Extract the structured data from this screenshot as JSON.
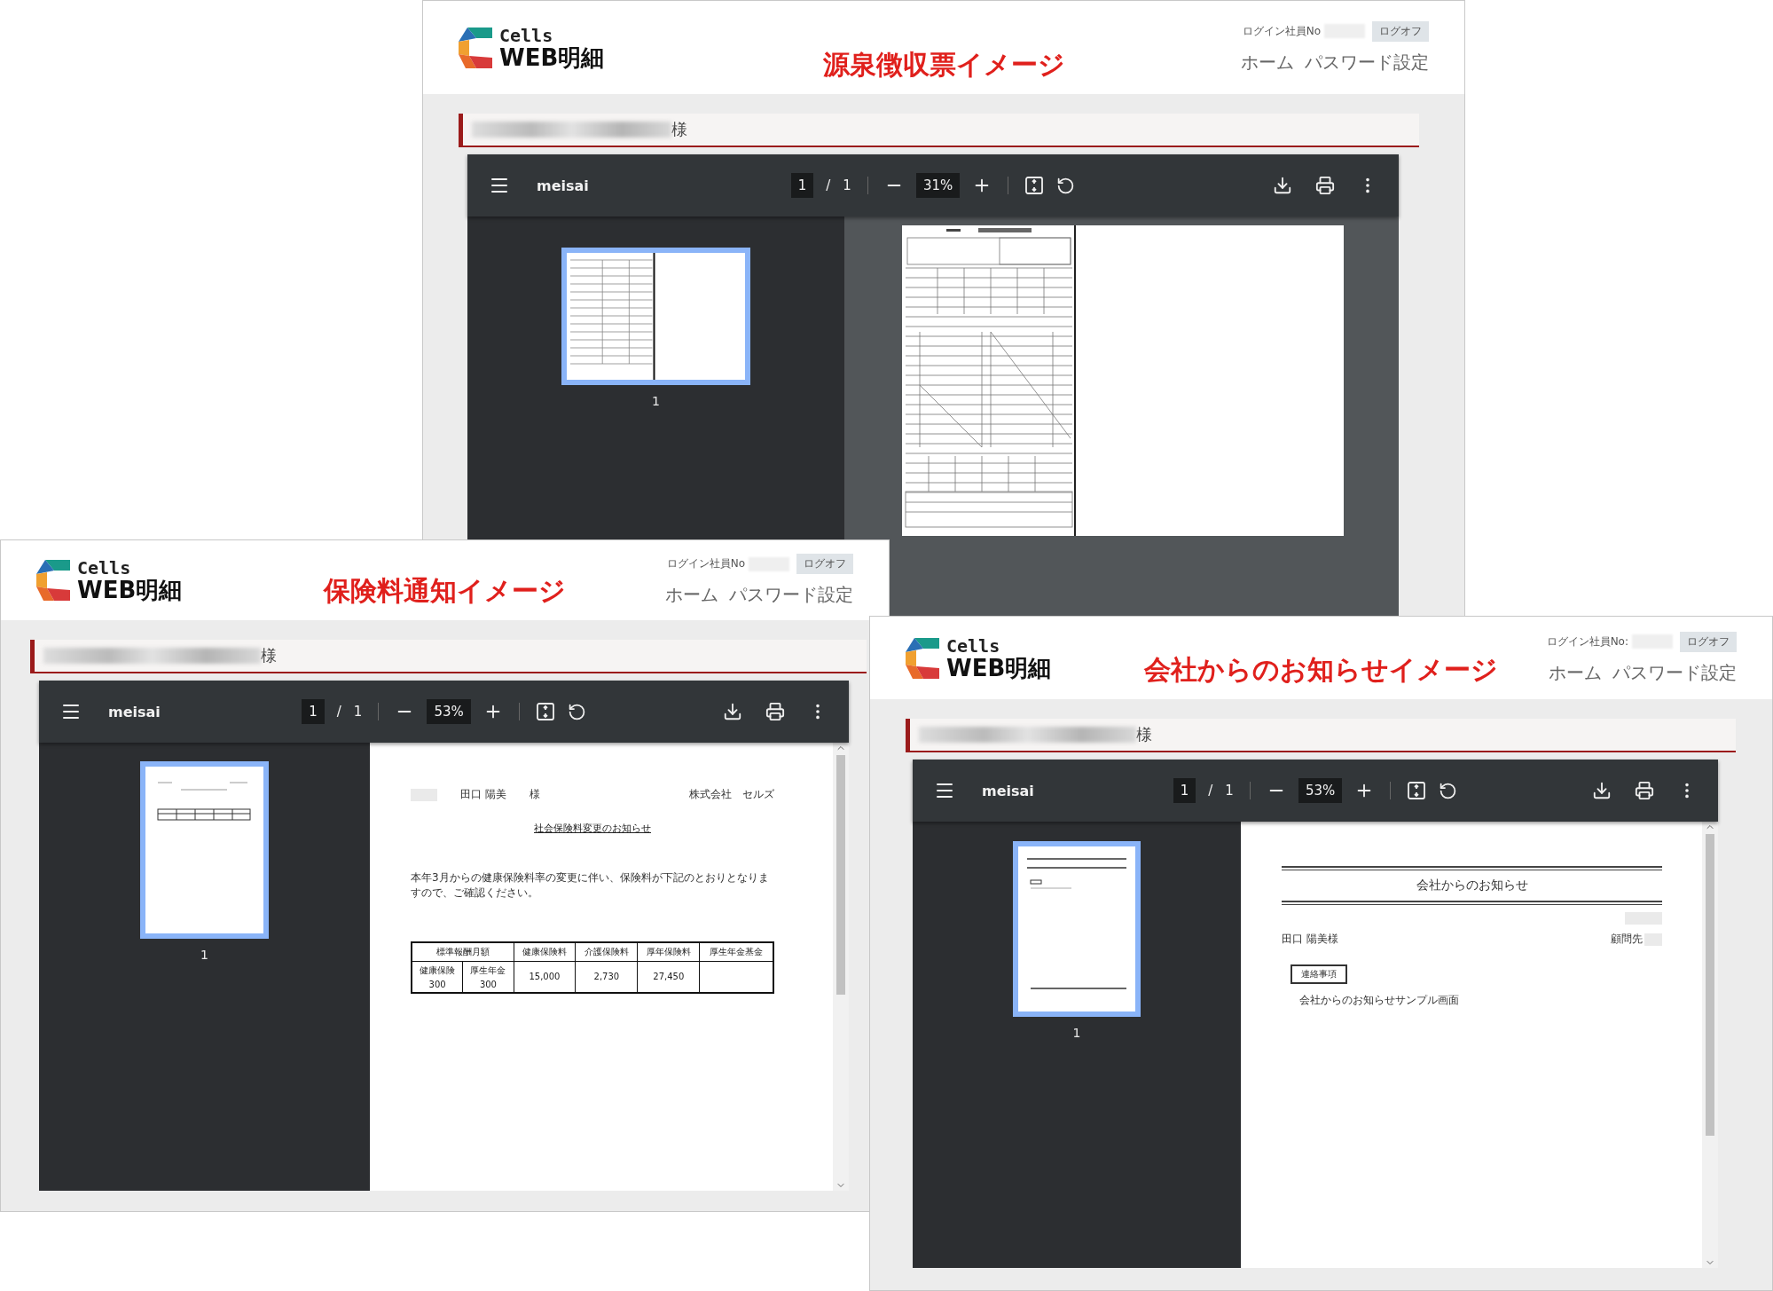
{
  "windows": [
    {
      "kind": "tax_slip",
      "logo": {
        "top": "Cells",
        "bottom": "WEB明細"
      },
      "caption": "源泉徴収票イメージ",
      "login_label": "ログイン社員No",
      "logout": "ログオフ",
      "nav": [
        "ホーム",
        "パスワード設定"
      ],
      "name_suffix": "様",
      "viewer": {
        "title": "meisai",
        "page": "1",
        "page_separator": "/",
        "page_count": "1",
        "zoom": "31%"
      },
      "thumbnail": {
        "label": "1",
        "selected": true
      }
    },
    {
      "kind": "notice",
      "logo": {
        "top": "Cells",
        "bottom": "WEB明細"
      },
      "caption": "保険料通知イメージ",
      "login_label": "ログイン社員No",
      "logout": "ログオフ",
      "nav": [
        "ホーム",
        "パスワード設定"
      ],
      "name_suffix": "様",
      "viewer": {
        "title": "meisai",
        "page": "1",
        "page_separator": "/",
        "page_count": "1",
        "zoom": "53%"
      },
      "thumbnail": {
        "label": "1",
        "selected": true
      },
      "document": {
        "recipient": "田口 陽美",
        "honorific": "様",
        "company": "株式会社　セルズ",
        "title": "社会保険料変更のお知らせ",
        "body": "本年3月からの健康保険料率の変更に伴い、保険料が下記のとおりとなりますので、ご確認ください。",
        "table": {
          "header": [
            "標準報酬月額",
            "健康保険料",
            "介護保険料",
            "厚年保険料",
            "厚生年金基金"
          ],
          "sub": [
            {
              "label": "健康保険",
              "value": "300"
            },
            {
              "label": "厚生年金",
              "value": "300"
            }
          ],
          "values": [
            "15,000",
            "2,730",
            "27,450"
          ]
        }
      }
    },
    {
      "kind": "company",
      "logo": {
        "top": "Cells",
        "bottom": "WEB明細"
      },
      "caption": "会社からのお知らせイメージ",
      "login_label": "ログイン社員No:",
      "logout": "ログオフ",
      "nav": [
        "ホーム",
        "パスワード設定"
      ],
      "name_suffix": "様",
      "viewer": {
        "title": "meisai",
        "page": "1",
        "page_separator": "/",
        "page_count": "1",
        "zoom": "53%"
      },
      "thumbnail": {
        "label": "1",
        "selected": true
      },
      "document": {
        "title": "会社からのお知らせ",
        "recipient": "田口 陽美様",
        "contact_label": "顧問先",
        "section": "連絡事項",
        "body": "会社からのお知らせサンプル画面"
      }
    }
  ]
}
